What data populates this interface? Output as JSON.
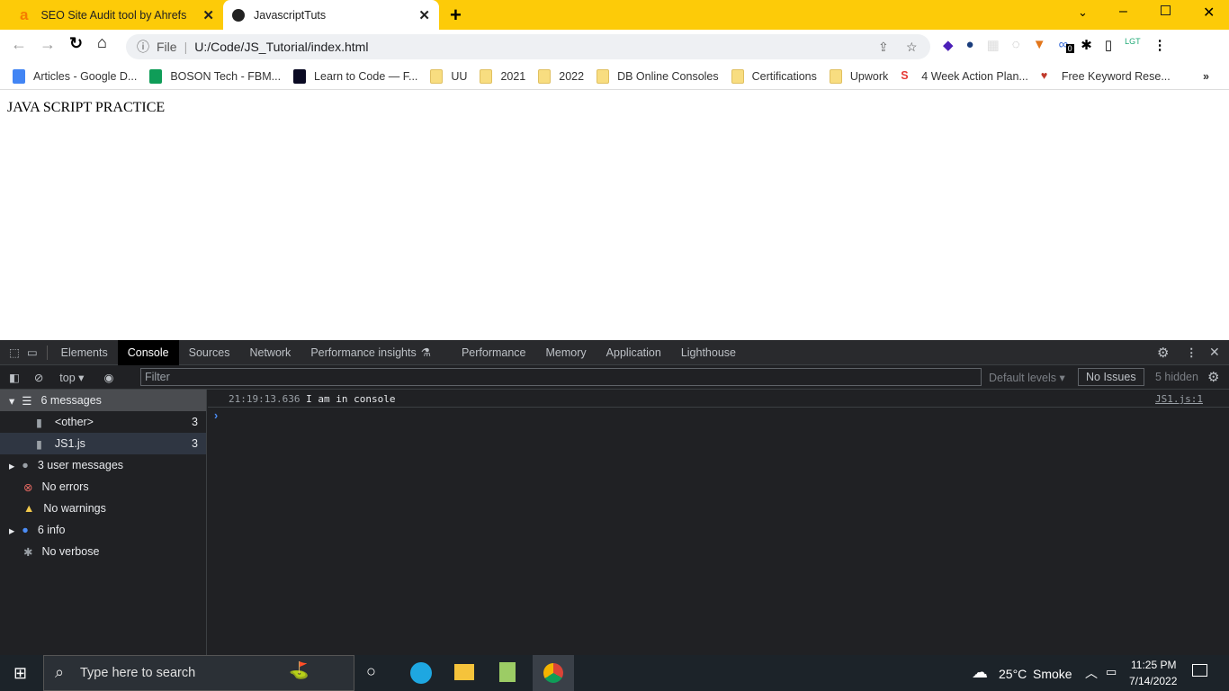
{
  "browser": {
    "tabs": [
      {
        "title": "SEO Site Audit tool by Ahrefs",
        "active": false
      },
      {
        "title": "JavascriptTuts",
        "active": true
      }
    ],
    "address": {
      "scheme_label": "File",
      "url": "U:/Code/JS_Tutorial/index.html"
    },
    "extension_badge": "0",
    "bookmarks": [
      {
        "label": "Articles - Google D...",
        "icon": "google-docs-icon"
      },
      {
        "label": "BOSON Tech - FBM...",
        "icon": "google-sheets-icon"
      },
      {
        "label": "Learn to Code — F...",
        "icon": "freecodecamp-icon"
      },
      {
        "label": "UU",
        "icon": "folder-icon"
      },
      {
        "label": "2021",
        "icon": "folder-icon"
      },
      {
        "label": "2022",
        "icon": "folder-icon"
      },
      {
        "label": "DB Online Consoles",
        "icon": "folder-icon"
      },
      {
        "label": "Certifications",
        "icon": "folder-icon"
      },
      {
        "label": "Upwork",
        "icon": "folder-icon"
      },
      {
        "label": "4 Week Action Plan...",
        "icon": "sync-icon"
      },
      {
        "label": "Free Keyword Rese...",
        "icon": "hero-icon"
      }
    ]
  },
  "page": {
    "heading": "JAVA SCRIPT PRACTICE"
  },
  "devtools": {
    "tabs": [
      "Elements",
      "Console",
      "Sources",
      "Network",
      "Performance insights",
      "Performance",
      "Memory",
      "Application",
      "Lighthouse"
    ],
    "active_tab": "Console",
    "context": "top",
    "filter_placeholder": "Filter",
    "levels": "Default levels",
    "issues": "No Issues",
    "hidden": "5 hidden",
    "sidebar": [
      {
        "label": "6 messages",
        "count": ""
      },
      {
        "label": "<other>",
        "count": "3"
      },
      {
        "label": "JS1.js",
        "count": "3"
      },
      {
        "label": "3 user messages",
        "count": ""
      },
      {
        "label": "No errors",
        "count": ""
      },
      {
        "label": "No warnings",
        "count": ""
      },
      {
        "label": "6 info",
        "count": ""
      },
      {
        "label": "No verbose",
        "count": ""
      }
    ],
    "messages": [
      {
        "timestamp": "21:19:13.636",
        "text": "I am in console",
        "source": "JS1.js:1"
      }
    ],
    "prompt": "›"
  },
  "taskbar": {
    "search_placeholder": "Type here to search",
    "weather_temp": "25°C",
    "weather_text": "Smoke",
    "time": "11:25 PM",
    "date": "7/14/2022"
  },
  "colors": {
    "tab_strip": "#fdcb08",
    "devtools_bg": "#202124",
    "taskbar": "#1c2329"
  }
}
